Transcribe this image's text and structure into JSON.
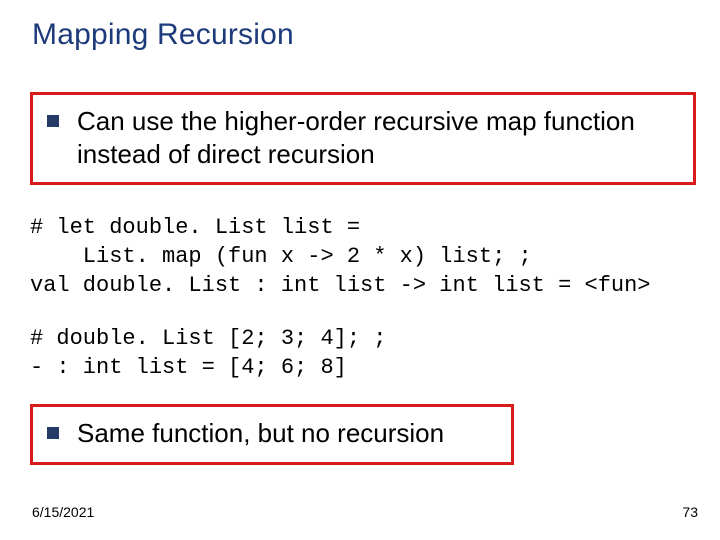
{
  "title": "Mapping Recursion",
  "bullets": {
    "b1": "Can use the higher-order recursive map function instead of direct recursion",
    "b2": "Same function, but no recursion"
  },
  "code": {
    "line1": "# let double. List list =",
    "line2": "    List. map (fun x -> 2 * x) list; ;",
    "line3": "val double. List : int list -> int list = <fun>",
    "line4": "# double. List [2; 3; 4]; ;",
    "line5": "- : int list = [4; 6; 8]"
  },
  "footer": {
    "date": "6/15/2021",
    "page": "73"
  }
}
